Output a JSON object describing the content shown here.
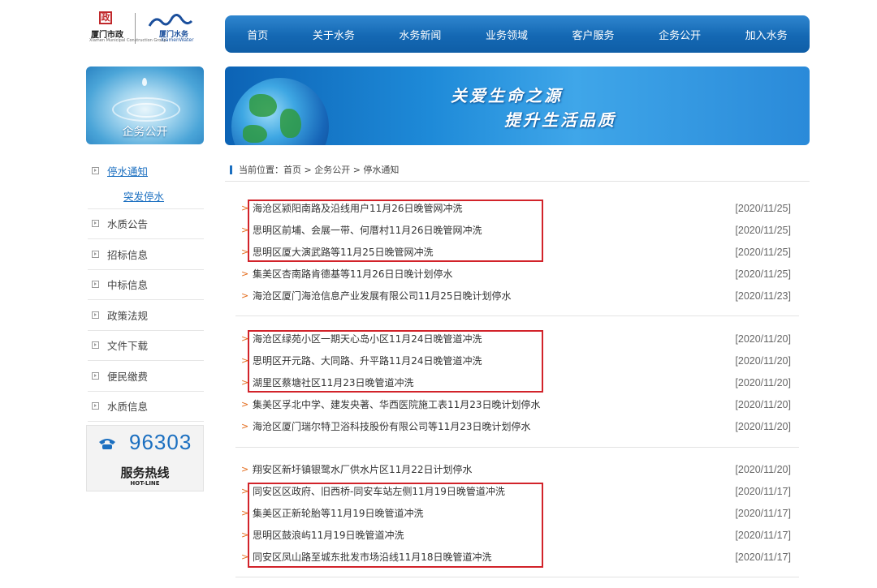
{
  "logo": {
    "municipal_name": "厦门市政",
    "municipal_sub": "Xiamen Municipal Construction Group",
    "water_name": "厦门水务",
    "water_sub": "XiamenWater"
  },
  "nav": [
    "首页",
    "关于水务",
    "水务新闻",
    "业务领域",
    "客户服务",
    "企务公开",
    "加入水务"
  ],
  "side_banner": {
    "label": "企务公开"
  },
  "main_banner": {
    "slogan_line1": "关爱生命之源",
    "slogan_line2": "提升生活品质"
  },
  "sidebar": {
    "items": [
      {
        "label": "停水通知",
        "active": true
      },
      {
        "label": "突发停水",
        "sub": true
      },
      {
        "label": "水质公告"
      },
      {
        "label": "招标信息"
      },
      {
        "label": "中标信息"
      },
      {
        "label": "政策法规"
      },
      {
        "label": "文件下载"
      },
      {
        "label": "便民缴费"
      },
      {
        "label": "水质信息"
      }
    ]
  },
  "hotline": {
    "number": "96303",
    "label": "服务热线",
    "label_en": "HOT-LINE"
  },
  "breadcrumb": {
    "text": "当前位置：首页 > 企务公开 > 停水通知"
  },
  "news": [
    [
      {
        "title": "海沧区颍阳南路及沿线用户11月26日晚管网冲洗",
        "date": "[2020/11/25]"
      },
      {
        "title": "思明区前埔、会展一带、何厝村11月26日晚管网冲洗",
        "date": "[2020/11/25]"
      },
      {
        "title": "思明区厦大演武路等11月25日晚管网冲洗",
        "date": "[2020/11/25]"
      },
      {
        "title": "集美区杏南路肯德基等11月26日日晚计划停水",
        "date": "[2020/11/25]"
      },
      {
        "title": "海沧区厦门海沧信息产业发展有限公司11月25日晚计划停水",
        "date": "[2020/11/23]"
      }
    ],
    [
      {
        "title": "海沧区绿苑小区一期天心岛小区11月24日晚管道冲洗",
        "date": "[2020/11/20]"
      },
      {
        "title": "思明区开元路、大同路、升平路11月24日晚管道冲洗",
        "date": "[2020/11/20]"
      },
      {
        "title": "湖里区蔡塘社区11月23日晚管道冲洗",
        "date": "[2020/11/20]"
      },
      {
        "title": "集美区孚北中学、建发央著、华西医院施工表11月23日晚计划停水",
        "date": "[2020/11/20]"
      },
      {
        "title": "海沧区厦门瑞尔特卫浴科技股份有限公司等11月23日晚计划停水",
        "date": "[2020/11/20]"
      }
    ],
    [
      {
        "title": "翔安区新圩镇银鹭水厂供水片区11月22日计划停水",
        "date": "[2020/11/20]"
      },
      {
        "title": "同安区区政府、旧西桥-同安车站左侧11月19日晚管道冲洗",
        "date": "[2020/11/17]"
      },
      {
        "title": "集美区正新轮胎等11月19日晚管道冲洗",
        "date": "[2020/11/17]"
      },
      {
        "title": "思明区鼓浪屿11月19日晚管道冲洗",
        "date": "[2020/11/17]"
      },
      {
        "title": "同安区凤山路至城东批发市场沿线11月18日晚管道冲洗",
        "date": "[2020/11/17]"
      }
    ]
  ],
  "colors": {
    "nav_blue": "#1468b3",
    "link_blue": "#1b6fc0",
    "arrow_orange": "#e36b1c",
    "highlight_red": "#d2232a"
  }
}
